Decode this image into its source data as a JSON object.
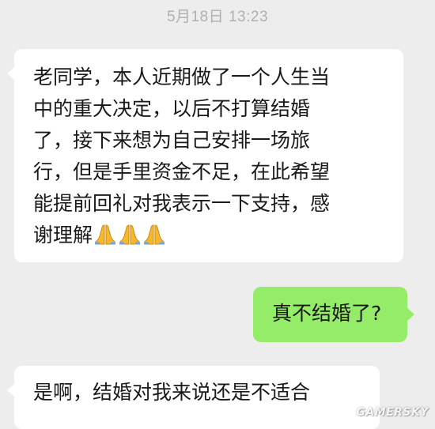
{
  "timestamp": "5月18日 13:23",
  "messages": [
    {
      "side": "left",
      "lines": [
        "老同学，本人近期做了一个人生当",
        "中的重大决定，以后不打算结婚",
        "了，接下来想为自己安排一场旅",
        "行，但是手里资金不足，在此希望",
        "能提前回礼对我表示一下支持，感",
        "谢理解"
      ],
      "emoji": [
        "folded-hands",
        "folded-hands",
        "folded-hands"
      ]
    },
    {
      "side": "right",
      "text": "真不结婚了?"
    },
    {
      "side": "left",
      "text": "是啊，结婚对我来说还是不适合"
    }
  ],
  "watermark": "GAMERSKY",
  "colors": {
    "background": "#ededed",
    "incoming_bubble": "#ffffff",
    "outgoing_bubble": "#95ec69",
    "timestamp_text": "#b0b0b0",
    "message_text": "#191919",
    "emoji_fill": "#f5b82e"
  }
}
